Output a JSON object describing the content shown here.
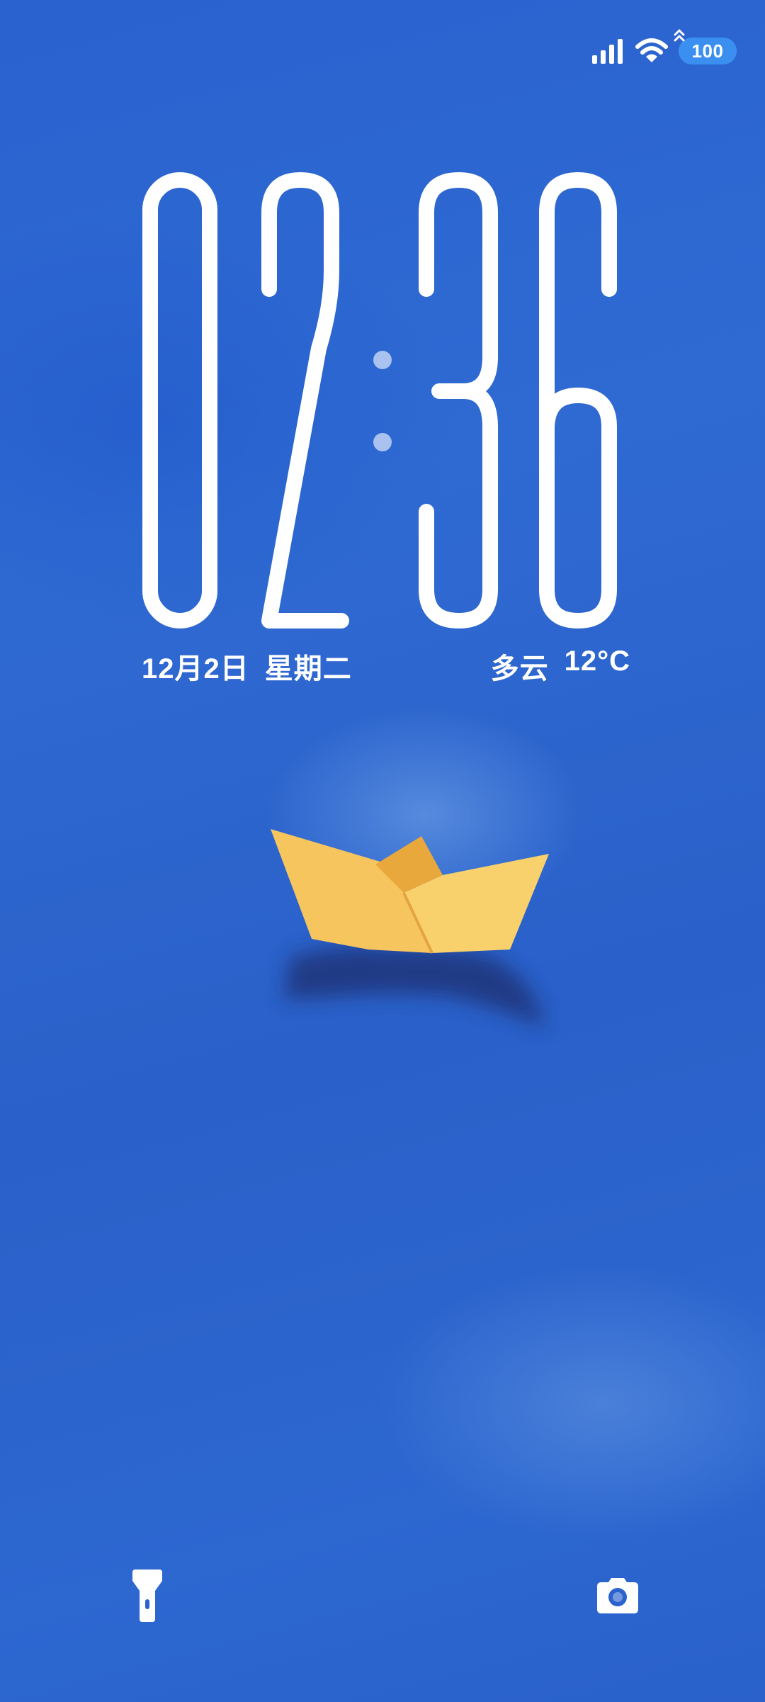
{
  "status_bar": {
    "signal_icon": "cellular-signal-icon",
    "wifi_icon": "wifi-icon",
    "charging_icon": "charging-arrow-icon",
    "battery_level": "100",
    "battery_fill_fraction": 1.0
  },
  "lock_screen": {
    "time": {
      "hours": "02",
      "minutes": "36"
    },
    "date": {
      "date_text": "12月2日",
      "weekday": "星期二"
    },
    "weather": {
      "condition": "多云",
      "temperature": "12°C"
    },
    "wallpaper": {
      "subject": "paper-boat-icon",
      "boat_color": "#f6c25a",
      "background_color": "#2b63cd"
    }
  },
  "quick_actions": {
    "flashlight_icon": "flashlight-icon",
    "camera_icon": "camera-icon"
  }
}
